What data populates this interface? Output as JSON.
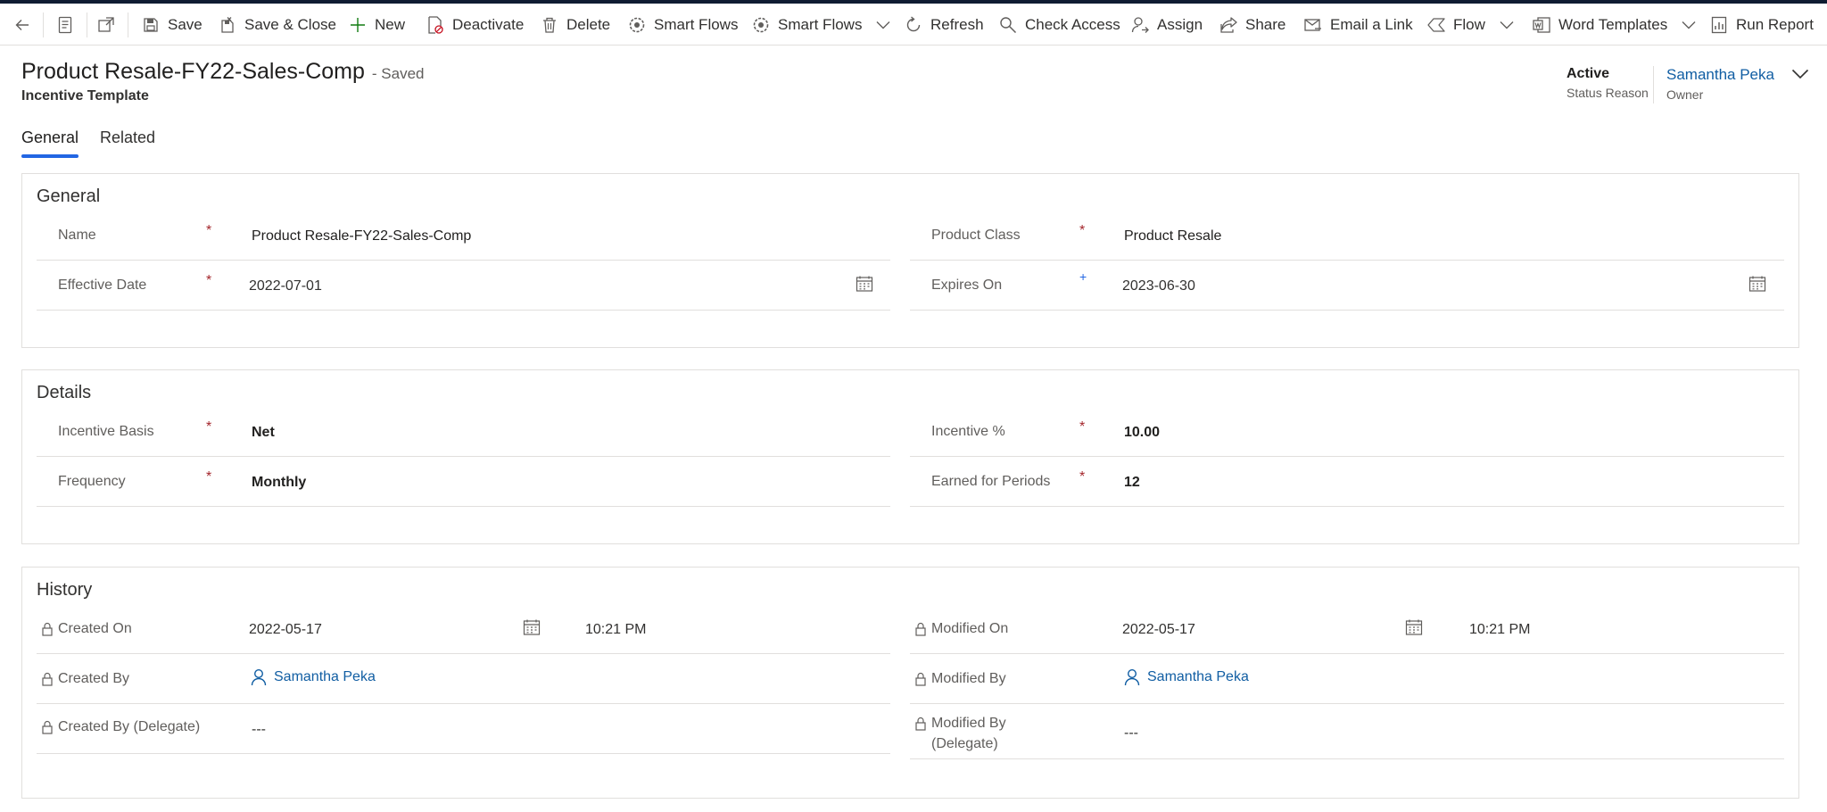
{
  "toolbar": {
    "save": "Save",
    "save_close": "Save & Close",
    "new": "New",
    "deactivate": "Deactivate",
    "delete": "Delete",
    "smart_flows_1": "Smart Flows",
    "smart_flows_2": "Smart Flows",
    "refresh": "Refresh",
    "check_access": "Check Access",
    "assign": "Assign",
    "share": "Share",
    "email_link": "Email a Link",
    "flow": "Flow",
    "word_templates": "Word Templates",
    "run_report": "Run Report"
  },
  "header": {
    "title": "Product Resale-FY22-Sales-Comp",
    "save_status": "- Saved",
    "entity": "Incentive Template",
    "status_value": "Active",
    "status_label": "Status Reason",
    "owner_value": "Samantha Peka",
    "owner_label": "Owner"
  },
  "tabs": {
    "general": "General",
    "related": "Related"
  },
  "general": {
    "title": "General",
    "name_label": "Name",
    "name_value": "Product Resale-FY22-Sales-Comp",
    "product_class_label": "Product Class",
    "product_class_value": "Product Resale",
    "effective_date_label": "Effective Date",
    "effective_date_value": "2022-07-01",
    "expires_on_label": "Expires On",
    "expires_on_value": "2023-06-30",
    "required_mark": "*",
    "recommended_mark": "+"
  },
  "details": {
    "title": "Details",
    "incentive_basis_label": "Incentive Basis",
    "incentive_basis_value": "Net",
    "incentive_pct_label": "Incentive %",
    "incentive_pct_value": "10.00",
    "frequency_label": "Frequency",
    "frequency_value": "Monthly",
    "earned_periods_label": "Earned for Periods",
    "earned_periods_value": "12",
    "required_mark": "*"
  },
  "history": {
    "title": "History",
    "created_on_label": "Created On",
    "created_on_date": "2022-05-17",
    "created_on_time": "10:21 PM",
    "modified_on_label": "Modified On",
    "modified_on_date": "2022-05-17",
    "modified_on_time": "10:21 PM",
    "created_by_label": "Created By",
    "created_by_value": "Samantha Peka",
    "modified_by_label": "Modified By",
    "modified_by_value": "Samantha Peka",
    "created_by_delegate_label": "Created By (Delegate)",
    "created_by_delegate_value": "---",
    "modified_by_delegate_label": "Modified By (Delegate)",
    "modified_by_delegate_value": "---"
  },
  "colors": {
    "accent": "#2266e3",
    "link": "#115ea3",
    "required": "#a4262c",
    "top_strip": "#0f1c32"
  }
}
